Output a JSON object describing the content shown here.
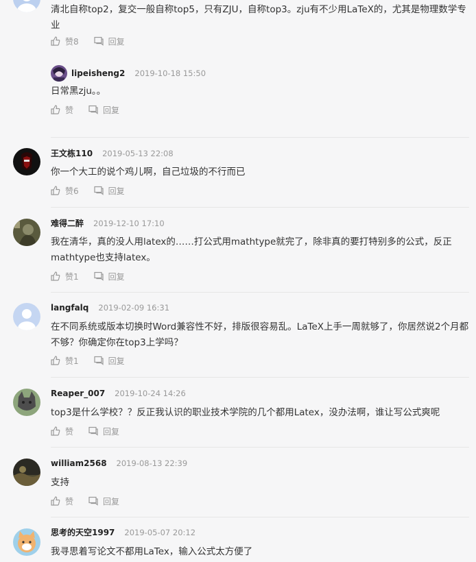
{
  "comments": [
    {
      "text": "清北自称top2，复交一般自称top5，只有ZJU，自称top3。zju有不少用LaTeX的，尤其是物理数学专业",
      "like_label": "赞8",
      "reply_label": "回复",
      "reply": {
        "username": "lipeisheng2",
        "time": "2019-10-18 15:50",
        "text": "日常黑zju。。",
        "like_label": "赞",
        "reply_label": "回复"
      }
    },
    {
      "username": "王文栋110",
      "time": "2019-05-13 22:08",
      "text": "你一个大工的说个鸡儿啊，自己垃圾的不行而已",
      "like_label": "赞6",
      "reply_label": "回复"
    },
    {
      "username": "难得二醉",
      "time": "2019-12-10 17:10",
      "text": "我在清华，真的没人用latex的……打公式用mathtype就完了，除非真的要打特别多的公式，反正mathtype也支持latex。",
      "like_label": "赞1",
      "reply_label": "回复"
    },
    {
      "username": "langfalq",
      "time": "2019-02-09 16:31",
      "text": "在不同系统或版本切换时Word兼容性不好，排版很容易乱。LaTeX上手一周就够了，你居然说2个月都不够？你确定你在top3上学吗？",
      "like_label": "赞1",
      "reply_label": "回复"
    },
    {
      "username": "Reaper_007",
      "time": "2019-10-24 14:26",
      "text": "top3是什么学校？？反正我认识的职业技术学院的几个都用Latex，没办法啊，谁让写公式爽呢",
      "like_label": "赞",
      "reply_label": "回复"
    },
    {
      "username": "william2568",
      "time": "2019-08-13 22:39",
      "text": "支持",
      "like_label": "赞",
      "reply_label": "回复"
    },
    {
      "username": "思考的天空1997",
      "time": "2019-05-07 20:12",
      "text": "我寻思着写论文不都用LaTex，输入公式太方便了"
    }
  ],
  "icons": {
    "like": "thumbs-up-icon",
    "reply": "comment-icon"
  },
  "colors": {
    "background": "#f6f6f7",
    "meta": "#999999",
    "text": "#333333",
    "divider": "#e6e6e6"
  }
}
